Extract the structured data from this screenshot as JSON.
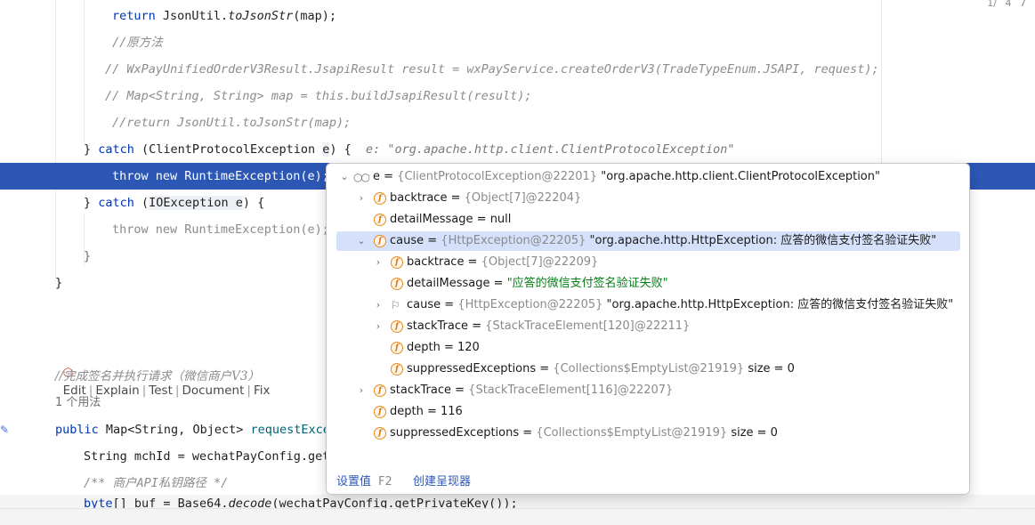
{
  "inspections": {
    "warnings": "1/",
    "weak": "4",
    "typos": "7"
  },
  "code": {
    "l1": "return JsonUtil.toJsonStr(map);",
    "l2": "//原方法",
    "l3": "// WxPayUnifiedOrderV3Result.JsapiResult result = wxPayService.createOrderV3(TradeTypeEnum.JSAPI, request);",
    "l4": "// Map<String, String> map = this.buildJsapiResult(result);",
    "l5": "//return JsonUtil.toJsonStr(map);",
    "l6": "} catch (ClientProtocolException e) {",
    "l6_hint": "e: \"org.apache.http.client.ClientProtocolException\"",
    "l7": "throw new RuntimeException(e);",
    "l8": "} catch (IOException e) {",
    "l9": "throw new RuntimeException(e);",
    "l10": "}",
    "l11": "}",
    "ann_edit": "Edit",
    "ann_explain": "Explain",
    "ann_test": "Test",
    "ann_document": "Document",
    "ann_fix": "Fix",
    "l12": "//完成签名并执行请求（微信商户V3）",
    "usages": "1 个用法",
    "l13": "public Map<String, Object> requestExce",
    "l14": "String mchId = wechatPayConfig.get",
    "l15": "/** 商户API私钥路径 */",
    "l16": "byte[] buf = Base64.decode(wechatPayConfig.getPrivateKey());"
  },
  "debugger": {
    "rows": [
      {
        "name": "e",
        "eq": " = ",
        "type": "{ClientProtocolException@22201}",
        "value": " \"org.apache.http.client.ClientProtocolException\"",
        "icon": "watch-icon",
        "expanded": true
      },
      {
        "name": "backtrace",
        "eq": " = ",
        "type": "{Object[7]@22204}",
        "value": "",
        "icon": "field-icon",
        "expanded": false
      },
      {
        "name": "detailMessage",
        "eq": " = ",
        "type": "",
        "value": "null",
        "icon": "field-icon"
      },
      {
        "name": "cause",
        "eq": " = ",
        "type": "{HttpException@22205}",
        "value": " \"org.apache.http.HttpException: 应答的微信支付签名验证失败\"",
        "icon": "field-icon",
        "expanded": true
      },
      {
        "name": "backtrace",
        "eq": " = ",
        "type": "{Object[7]@22209}",
        "value": "",
        "icon": "field-icon",
        "expanded": false
      },
      {
        "name": "detailMessage",
        "eq": " = ",
        "type": "",
        "value": "\"应答的微信支付签名验证失败\"",
        "icon": "field-icon"
      },
      {
        "name": "cause",
        "eq": " = ",
        "type": "{HttpException@22205}",
        "value": " \"org.apache.http.HttpException: 应答的微信支付签名验证失败\"",
        "icon": "flag-icon",
        "expanded": false
      },
      {
        "name": "stackTrace",
        "eq": " = ",
        "type": "{StackTraceElement[120]@22211}",
        "value": "",
        "icon": "field-icon",
        "expanded": false
      },
      {
        "name": "depth",
        "eq": " = ",
        "type": "",
        "value": "120",
        "icon": "field-icon"
      },
      {
        "name": "suppressedExceptions",
        "eq": " = ",
        "type": "{Collections$EmptyList@21919}",
        "value": "  size = 0",
        "icon": "field-icon"
      },
      {
        "name": "stackTrace",
        "eq": " = ",
        "type": "{StackTraceElement[116]@22207}",
        "value": "",
        "icon": "field-icon",
        "expanded": false
      },
      {
        "name": "depth",
        "eq": " = ",
        "type": "",
        "value": "116",
        "icon": "field-icon"
      },
      {
        "name": "suppressedExceptions",
        "eq": " = ",
        "type": "{Collections$EmptyList@21919}",
        "value": "  size = 0",
        "icon": "field-icon"
      }
    ],
    "footer": {
      "set_value": "设置值",
      "set_value_key": "F2",
      "create_renderer": "创建呈现器"
    }
  }
}
